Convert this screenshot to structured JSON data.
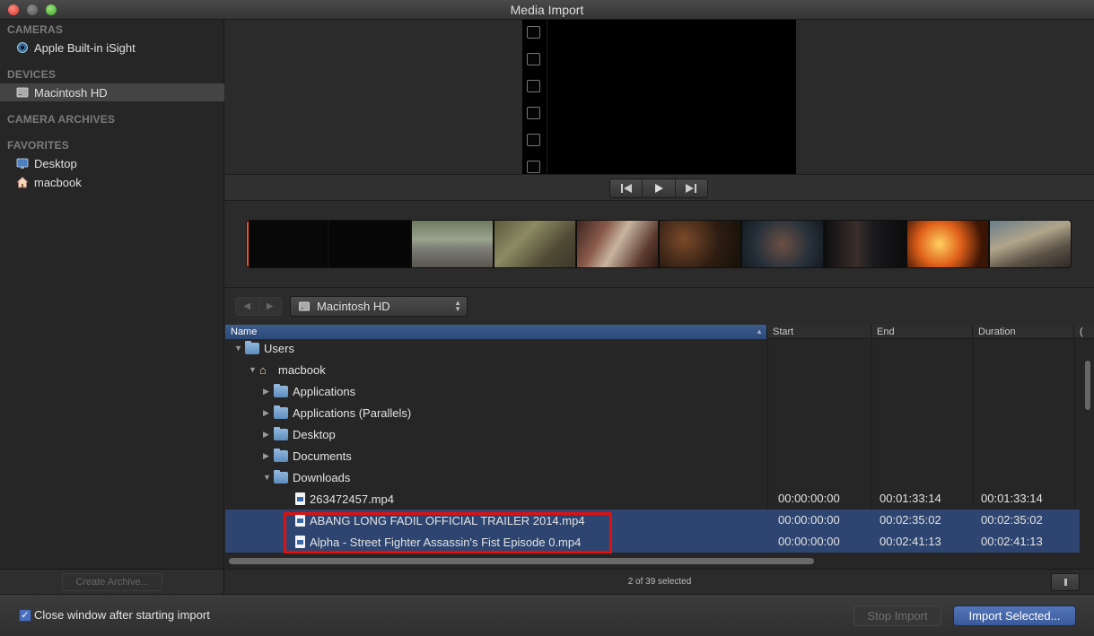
{
  "window": {
    "title": "Media Import"
  },
  "sidebar": {
    "sections": [
      {
        "header": "CAMERAS",
        "items": [
          {
            "label": "Apple Built-in iSight",
            "icon": "camera-icon"
          }
        ]
      },
      {
        "header": "DEVICES",
        "items": [
          {
            "label": "Macintosh HD",
            "icon": "hard-drive-icon",
            "selected": true
          }
        ]
      },
      {
        "header": "CAMERA ARCHIVES",
        "items": []
      },
      {
        "header": "FAVORITES",
        "items": [
          {
            "label": "Desktop",
            "icon": "desktop-icon"
          },
          {
            "label": "macbook",
            "icon": "home-icon"
          }
        ]
      }
    ],
    "create_archive_label": "Create Archive..."
  },
  "browser": {
    "location": "Macintosh HD"
  },
  "table": {
    "columns": [
      "Name",
      "Start",
      "End",
      "Duration"
    ],
    "rows": [
      {
        "name": "Users",
        "kind": "folder",
        "expanded": true,
        "start": "",
        "end": "",
        "duration": ""
      },
      {
        "name": "macbook",
        "kind": "home",
        "expanded": true,
        "start": "",
        "end": "",
        "duration": ""
      },
      {
        "name": "Applications",
        "kind": "folder",
        "expanded": false,
        "start": "",
        "end": "",
        "duration": ""
      },
      {
        "name": "Applications (Parallels)",
        "kind": "folder",
        "expanded": false,
        "start": "",
        "end": "",
        "duration": ""
      },
      {
        "name": "Desktop",
        "kind": "folder",
        "expanded": false,
        "start": "",
        "end": "",
        "duration": ""
      },
      {
        "name": "Documents",
        "kind": "folder",
        "expanded": false,
        "start": "",
        "end": "",
        "duration": ""
      },
      {
        "name": "Downloads",
        "kind": "folder",
        "expanded": true,
        "start": "",
        "end": "",
        "duration": ""
      },
      {
        "name": "263472457.mp4",
        "kind": "file",
        "start": "00:00:00:00",
        "end": "00:01:33:14",
        "duration": "00:01:33:14"
      },
      {
        "name": "ABANG LONG FADIL OFFICIAL TRAILER 2014.mp4",
        "kind": "file",
        "selected": true,
        "start": "00:00:00:00",
        "end": "00:02:35:02",
        "duration": "00:02:35:02"
      },
      {
        "name": "Alpha - Street Fighter Assassin's Fist Episode 0.mp4",
        "kind": "file",
        "selected": true,
        "start": "00:00:00:00",
        "end": "00:02:41:13",
        "duration": "00:02:41:13"
      }
    ]
  },
  "status": {
    "text": "2 of 39 selected"
  },
  "footer": {
    "close_window_label": "Close window after starting import",
    "close_window_checked": true,
    "stop_import_label": "Stop Import",
    "import_selected_label": "Import Selected..."
  },
  "colors": {
    "selection": "#2d4570",
    "accent": "#3a5a9c",
    "highlight_box": "#e01010"
  }
}
